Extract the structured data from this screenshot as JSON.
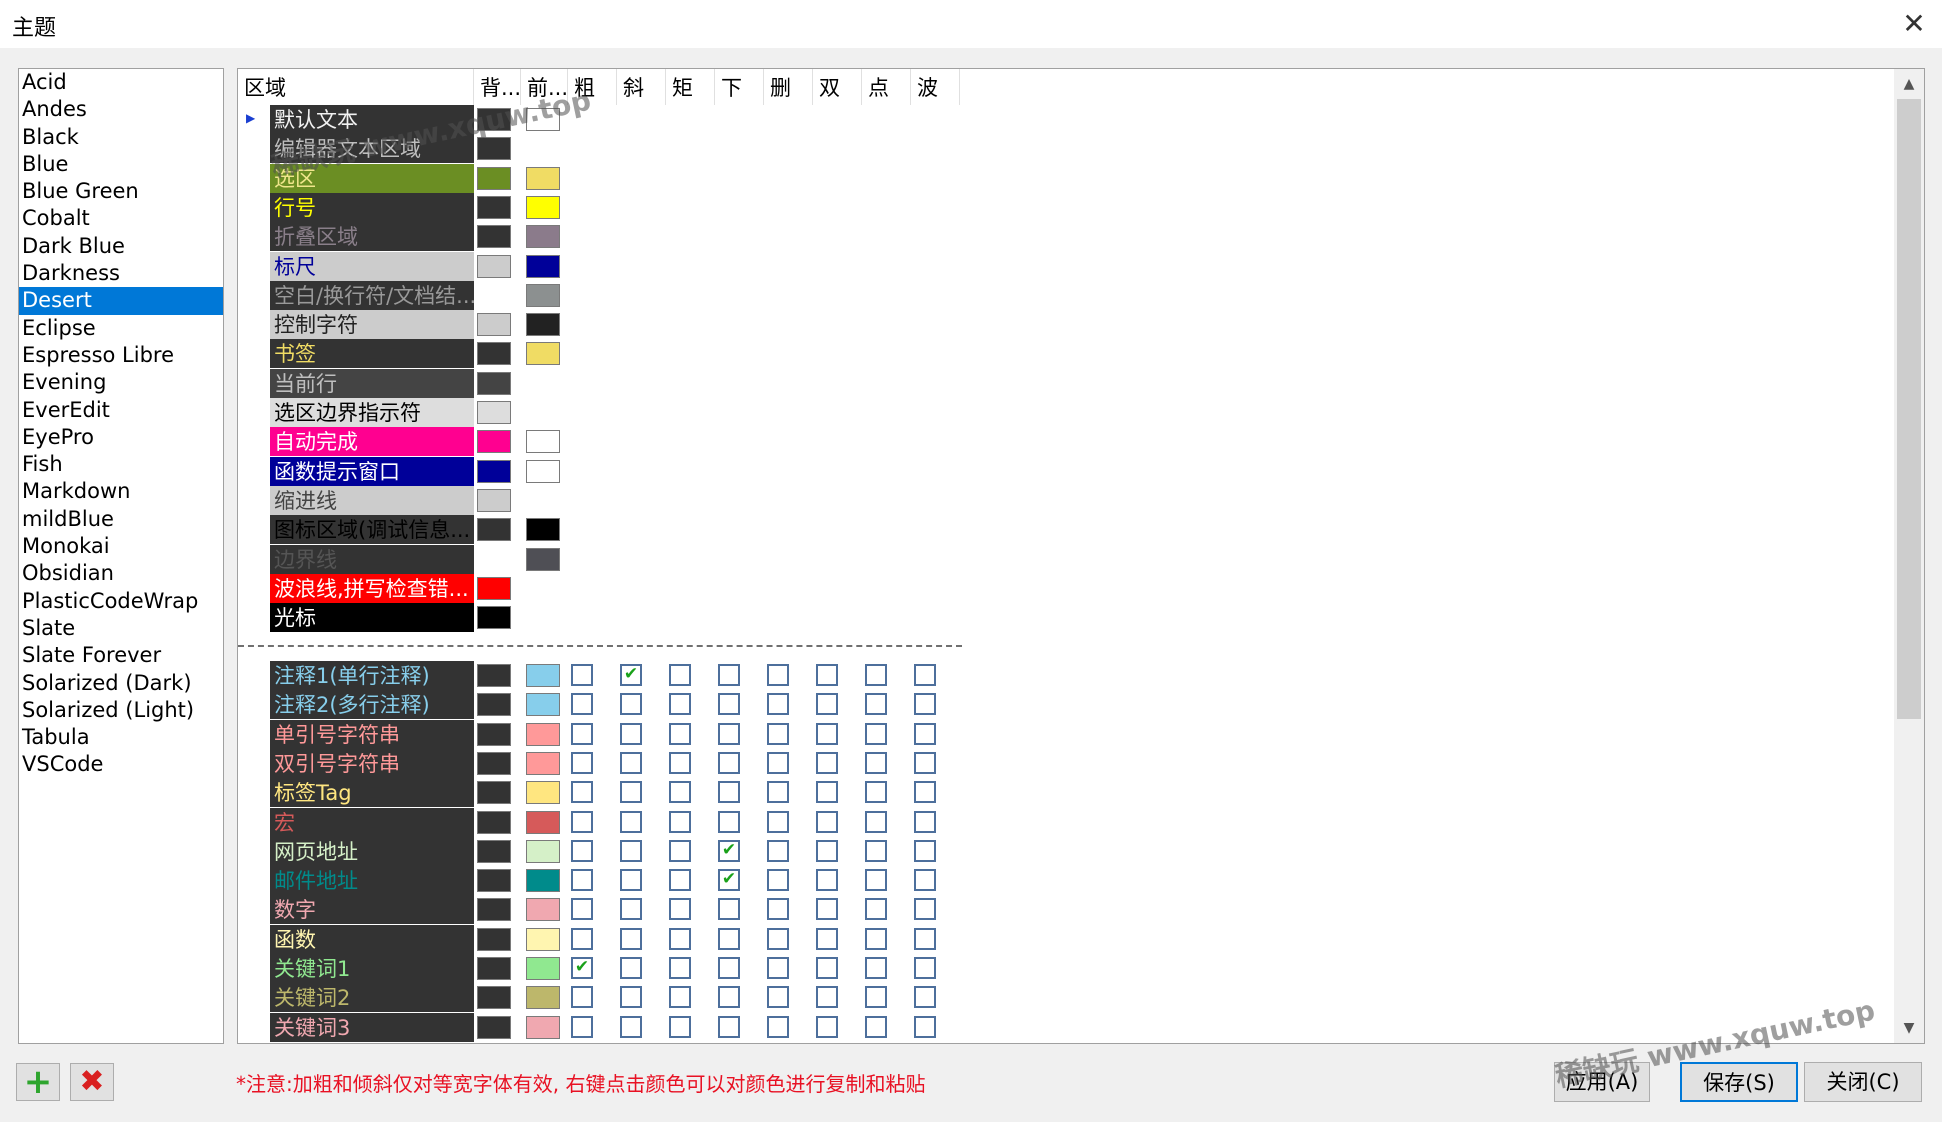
{
  "window": {
    "title": "主题",
    "close_label": "✕"
  },
  "themes": {
    "selected": "Desert",
    "items": [
      "Acid",
      "Andes",
      "Black",
      "Blue",
      "Blue Green",
      "Cobalt",
      "Dark Blue",
      "Darkness",
      "Desert",
      "Eclipse",
      "Espresso Libre",
      "Evening",
      "EverEdit",
      "EyePro",
      "Fish",
      "Markdown",
      "mildBlue",
      "Monokai",
      "Obsidian",
      "PlasticCodeWrap",
      "Slate",
      "Slate Forever",
      "Solarized (Dark)",
      "Solarized (Light)",
      "Tabula",
      "VSCode"
    ]
  },
  "grid": {
    "headers": [
      "区域",
      "背...",
      "前...",
      "粗",
      "斜",
      "矩",
      "下",
      "删",
      "双",
      "点",
      "波"
    ],
    "ui_rows": [
      {
        "name": "默认文本",
        "name_bg": "#333333",
        "name_fg": "#f2f2f2",
        "bg": "#333333",
        "fg": "#ffffff"
      },
      {
        "name": "编辑器文本区域",
        "name_bg": "#333333",
        "name_fg": "#bfbfbf",
        "bg": "#333333",
        "fg": null
      },
      {
        "name": "选区",
        "name_bg": "#6b8e23",
        "name_fg": "#f0e68c",
        "bg": "#6b8e23",
        "fg": "#f0dc64"
      },
      {
        "name": "行号",
        "name_bg": "#333333",
        "name_fg": "#ffff00",
        "bg": "#333333",
        "fg": "#ffff00"
      },
      {
        "name": "折叠区域",
        "name_bg": "#333333",
        "name_fg": "#8a7f8a",
        "bg": "#333333",
        "fg": "#8b7b8b"
      },
      {
        "name": "标尺",
        "name_bg": "#cccccc",
        "name_fg": "#000099",
        "bg": "#cccccc",
        "fg": "#000099"
      },
      {
        "name": "空白/换行符/文档结...",
        "name_bg": "#333333",
        "name_fg": "#999999",
        "bg": null,
        "fg": "#8c9090"
      },
      {
        "name": "控制字符",
        "name_bg": "#cccccc",
        "name_fg": "#222222",
        "bg": "#cccccc",
        "fg": "#222222"
      },
      {
        "name": "书签",
        "name_bg": "#333333",
        "name_fg": "#f0dc64",
        "bg": "#333333",
        "fg": "#f0dc64"
      },
      {
        "name": "当前行",
        "name_bg": "#444444",
        "name_fg": "#bfbfbf",
        "bg": "#444444",
        "fg": null
      },
      {
        "name": "选区边界指示符",
        "name_bg": "#dddddd",
        "name_fg": "#000000",
        "bg": "#dddddd",
        "fg": null
      },
      {
        "name": "自动完成",
        "name_bg": "#ff0090",
        "name_fg": "#ffffff",
        "bg": "#ff0090",
        "fg": "#ffffff"
      },
      {
        "name": "函数提示窗口",
        "name_bg": "#000099",
        "name_fg": "#ffffff",
        "bg": "#000099",
        "fg": "#ffffff"
      },
      {
        "name": "缩进线",
        "name_bg": "#cccccc",
        "name_fg": "#444444",
        "bg": "#cccccc",
        "fg": null
      },
      {
        "name": "图标区域(调试信息...",
        "name_bg": "#333333",
        "name_fg": "#000000",
        "bg": "#333333",
        "fg": "#000000"
      },
      {
        "name": "边界线",
        "name_bg": "#333333",
        "name_fg": "#555555",
        "bg": null,
        "fg": "#4f4f55"
      },
      {
        "name": "波浪线,拼写检查错...",
        "name_bg": "#ff0000",
        "name_fg": "#ffffff",
        "bg": "#ff0000",
        "fg": null
      },
      {
        "name": "光标",
        "name_bg": "#000000",
        "name_fg": "#ffffff",
        "bg": "#000000",
        "fg": null
      }
    ],
    "syntax_rows": [
      {
        "name": "注释1(单行注释)",
        "fg": "#87ceeb",
        "bg": "#333333",
        "checks": [
          false,
          true,
          false,
          false,
          false,
          false,
          false,
          false
        ]
      },
      {
        "name": "注释2(多行注释)",
        "fg": "#87ceeb",
        "bg": "#333333",
        "checks": [
          false,
          false,
          false,
          false,
          false,
          false,
          false,
          false
        ]
      },
      {
        "name": "单引号字符串",
        "fg": "#ff9999",
        "bg": "#333333",
        "checks": [
          false,
          false,
          false,
          false,
          false,
          false,
          false,
          false
        ]
      },
      {
        "name": "双引号字符串",
        "fg": "#ff9999",
        "bg": "#333333",
        "checks": [
          false,
          false,
          false,
          false,
          false,
          false,
          false,
          false
        ]
      },
      {
        "name": "标签Tag",
        "fg": "#ffe680",
        "bg": "#333333",
        "checks": [
          false,
          false,
          false,
          false,
          false,
          false,
          false,
          false
        ]
      },
      {
        "name": "宏",
        "fg": "#d65a5a",
        "bg": "#333333",
        "checks": [
          false,
          false,
          false,
          false,
          false,
          false,
          false,
          false
        ]
      },
      {
        "name": "网页地址",
        "fg": "#d5f0c8",
        "bg": "#333333",
        "checks": [
          false,
          false,
          false,
          true,
          false,
          false,
          false,
          false
        ]
      },
      {
        "name": "邮件地址",
        "fg": "#008b8b",
        "bg": "#333333",
        "checks": [
          false,
          false,
          false,
          true,
          false,
          false,
          false,
          false
        ]
      },
      {
        "name": "数字",
        "fg": "#f0a8b0",
        "bg": "#333333",
        "checks": [
          false,
          false,
          false,
          false,
          false,
          false,
          false,
          false
        ]
      },
      {
        "name": "函数",
        "fg": "#fff5b0",
        "bg": "#333333",
        "checks": [
          false,
          false,
          false,
          false,
          false,
          false,
          false,
          false
        ]
      },
      {
        "name": "关键词1",
        "fg": "#90e890",
        "bg": "#333333",
        "checks": [
          true,
          false,
          false,
          false,
          false,
          false,
          false,
          false
        ]
      },
      {
        "name": "关键词2",
        "fg": "#bdb76b",
        "bg": "#333333",
        "checks": [
          false,
          false,
          false,
          false,
          false,
          false,
          false,
          false
        ]
      },
      {
        "name": "关键词3",
        "fg": "#f0a8b0",
        "bg": "#333333",
        "checks": [
          false,
          false,
          false,
          false,
          false,
          false,
          false,
          false
        ]
      }
    ]
  },
  "footer": {
    "add_label": "+",
    "delete_label": "✖",
    "note": "*注意:加粗和倾斜仅对等宽字体有效, 右键点击颜色可以对颜色进行复制和粘贴",
    "apply": "应用(A)",
    "save": "保存(S)",
    "close": "关闭(C)"
  },
  "watermark": "稀缺玩 www.xquw.top"
}
